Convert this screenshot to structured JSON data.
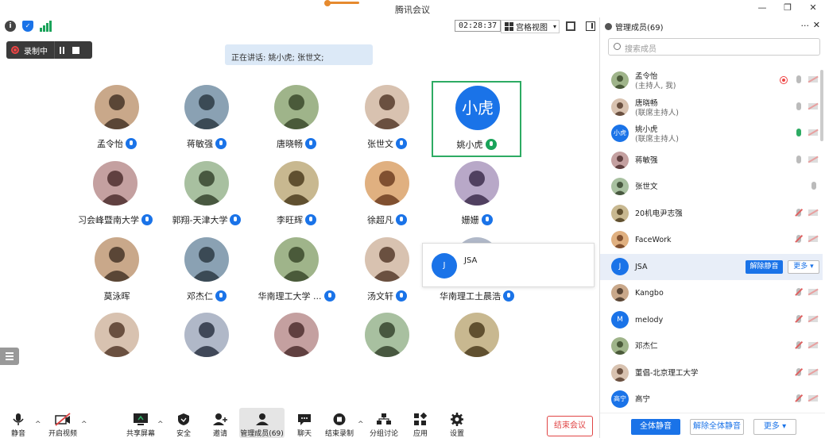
{
  "window": {
    "title": "腾讯会议"
  },
  "topbar": {
    "timer": "02:28:37",
    "view_label": "宫格视图"
  },
  "recording": {
    "label": "录制中"
  },
  "speaking": {
    "text": "正在讲话: 姚小虎; 张世文;"
  },
  "grid": [
    {
      "name": "孟令怡",
      "mic": "blue",
      "avatar": "cartoon"
    },
    {
      "name": "蒋敏强",
      "mic": "blue",
      "avatar": "photo"
    },
    {
      "name": "唐晓畅",
      "mic": "blue",
      "avatar": "photo"
    },
    {
      "name": "张世文",
      "mic": "blue",
      "avatar": "photo"
    },
    {
      "name": "姚小虎",
      "mic": "green",
      "avatar": "text",
      "avatar_text": "小虎",
      "active": true
    },
    {
      "name": "习会峰暨南大学",
      "mic": "blue",
      "avatar": "photo"
    },
    {
      "name": "郭翔-天津大学",
      "mic": "blue",
      "avatar": "photo"
    },
    {
      "name": "李旺辉",
      "mic": "blue",
      "avatar": "photo"
    },
    {
      "name": "徐超凡",
      "mic": "blue",
      "avatar": "photo"
    },
    {
      "name": "姗姗",
      "mic": "blue",
      "avatar": "cartoon"
    },
    {
      "name": "莫泳晖",
      "mic": "none",
      "avatar": "cartoon"
    },
    {
      "name": "邓杰仁",
      "mic": "blue",
      "avatar": "cartoon"
    },
    {
      "name": "华南理工大学 ...",
      "mic": "blue",
      "avatar": "photo"
    },
    {
      "name": "汤文轩",
      "mic": "blue",
      "avatar": "cartoon"
    },
    {
      "name": "华南理工土晨浩",
      "mic": "blue",
      "avatar": "photo"
    }
  ],
  "popup": {
    "avatar": "J",
    "name": "JSA"
  },
  "toolbar": {
    "mute": "静音",
    "video": "开启视频",
    "share": "共享屏幕",
    "security": "安全",
    "invite": "邀请",
    "members": "管理成员(69)",
    "chat": "聊天",
    "end_record": "结束录制",
    "breakout": "分组讨论",
    "apps": "应用",
    "settings": "设置",
    "end_meeting": "结束会议"
  },
  "panel": {
    "title": "管理成员(69)",
    "more": "···",
    "close": "✕",
    "search_placeholder": "搜索成员",
    "members": [
      {
        "name": "孟令怡",
        "sub": "(主持人, 我)",
        "mic": "gray",
        "rec": true
      },
      {
        "name": "唐晓畅",
        "sub": "(联席主持人)",
        "mic": "gray"
      },
      {
        "name": "姚小虎",
        "sub": "(联席主持人)",
        "mic": "green",
        "avatar_text": "小虎"
      },
      {
        "name": "蒋敏强",
        "mic": "gray"
      },
      {
        "name": "张世文",
        "mic": "gray",
        "no_cam": true
      },
      {
        "name": "20机电尹志强",
        "mic": "muted"
      },
      {
        "name": "FaceWork",
        "mic": "muted"
      },
      {
        "name": "JSA",
        "mic": "muted",
        "avatar_text": "J",
        "highlight": true,
        "unmute_label": "解除静音",
        "more_label": "更多 ▾"
      },
      {
        "name": "Kangbo",
        "mic": "muted"
      },
      {
        "name": "melody",
        "mic": "muted",
        "avatar_text": "M"
      },
      {
        "name": "邓杰仁",
        "mic": "muted"
      },
      {
        "name": "董倡-北京理工大学",
        "mic": "muted"
      },
      {
        "name": "高宁",
        "mic": "muted",
        "avatar_text": "高宁"
      }
    ],
    "footer": {
      "mute_all": "全体静音",
      "unmute_all": "解除全体静音",
      "more": "更多 ▾"
    }
  },
  "colors": {
    "accent": "#1a73e8",
    "active_border": "#2dab63",
    "end_red": "#e04545"
  }
}
